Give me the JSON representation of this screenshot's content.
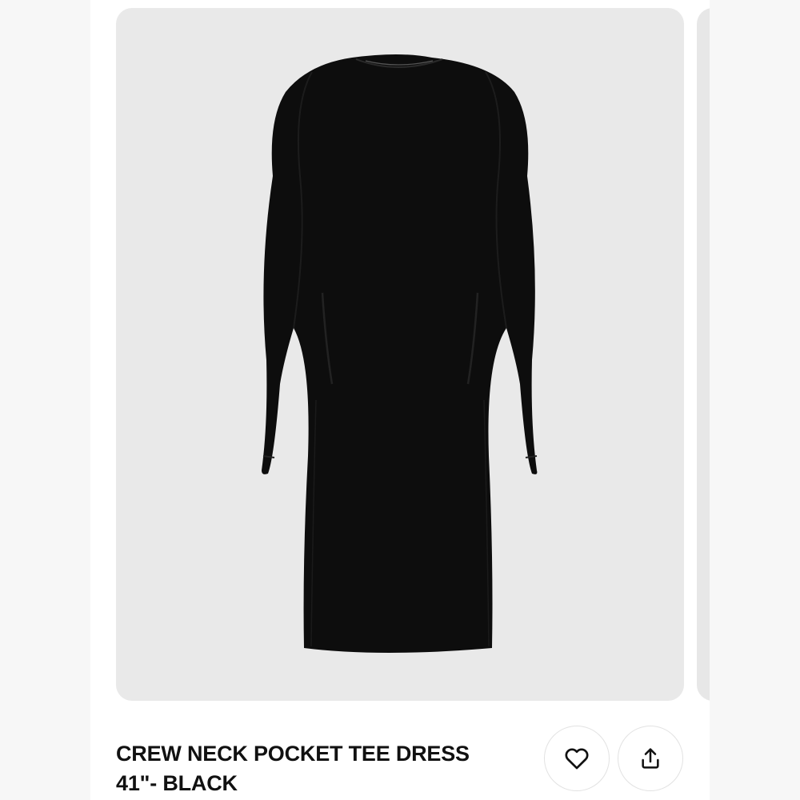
{
  "product": {
    "title": "CREW NECK POCKET TEE DRESS 41\"- BLACK",
    "image_alt": "Black long-sleeve crew neck pocket tee dress",
    "image_background": "#e9e9e9",
    "garment_color": "#0d0d0d"
  },
  "actions": {
    "favorite_icon": "heart-icon",
    "share_icon": "share-upload-icon"
  }
}
